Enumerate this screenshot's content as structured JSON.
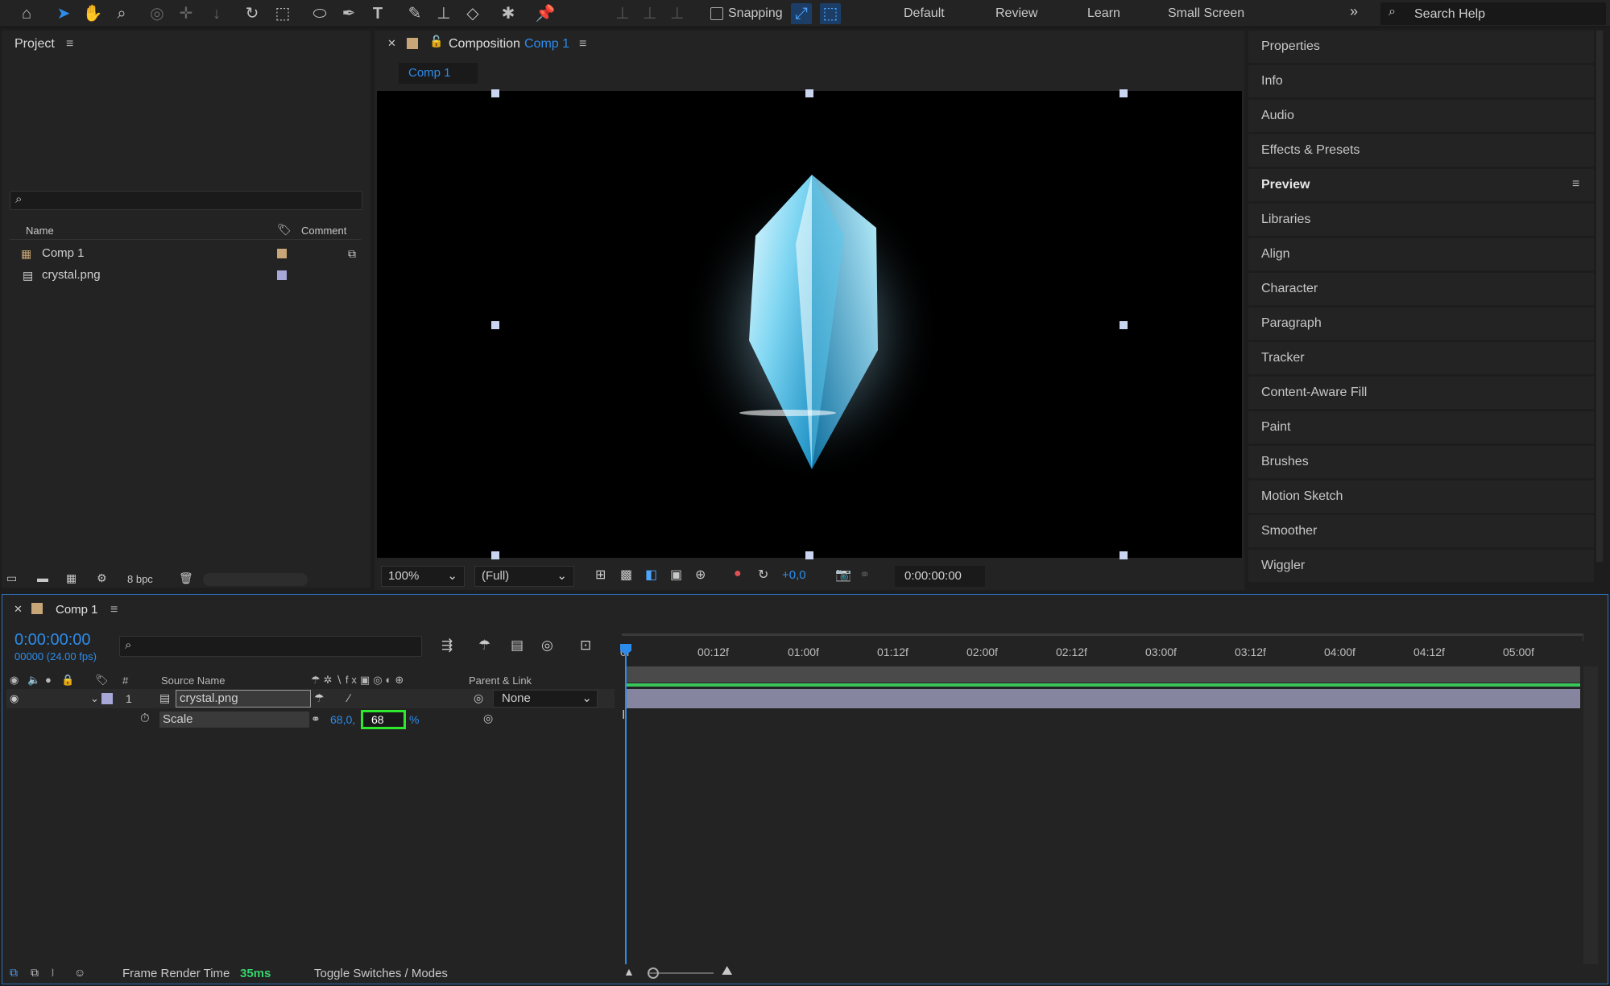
{
  "toolbar": {
    "snapping_label": "Snapping",
    "workspaces": [
      "Default",
      "Review",
      "Learn",
      "Small Screen"
    ],
    "search_placeholder": "Search Help"
  },
  "project": {
    "title": "Project",
    "columns": {
      "name": "Name",
      "comment": "Comment"
    },
    "items": [
      {
        "name": "Comp 1",
        "color": "#c8a678"
      },
      {
        "name": "crystal.png",
        "color": "#a7a7d8"
      }
    ],
    "bpc": "8 bpc"
  },
  "composition": {
    "panel_label": "Composition",
    "comp_name": "Comp 1",
    "tab": "Comp 1",
    "zoom": "100%",
    "resolution": "(Full)",
    "exposure": "+0,0",
    "timecode": "0:00:00:00"
  },
  "right_panel": {
    "items": [
      "Properties",
      "Info",
      "Audio",
      "Effects & Presets",
      "Preview",
      "Libraries",
      "Align",
      "Character",
      "Paragraph",
      "Tracker",
      "Content-Aware Fill",
      "Paint",
      "Brushes",
      "Motion Sketch",
      "Smoother",
      "Wiggler"
    ]
  },
  "timeline": {
    "tab": "Comp 1",
    "timecode": "0:00:00:00",
    "fps": "00000 (24.00 fps)",
    "ruler": [
      "0f",
      "00:12f",
      "01:00f",
      "01:12f",
      "02:00f",
      "02:12f",
      "03:00f",
      "03:12f",
      "04:00f",
      "04:12f",
      "05:00f"
    ],
    "columns": {
      "num": "#",
      "source": "Source Name",
      "parent": "Parent & Link"
    },
    "layer": {
      "index": "1",
      "name": "crystal.png",
      "parent": "None",
      "color": "#a7a7d8"
    },
    "property": {
      "name": "Scale",
      "value1": "68,0,",
      "value2_input": "68",
      "unit": "%"
    },
    "status": {
      "frame_render_label": "Frame Render Time",
      "frame_render_value": "35ms",
      "toggle": "Toggle Switches / Modes"
    }
  },
  "colors": {
    "accent": "#2d8ceb",
    "highlight": "#2ee82e"
  }
}
